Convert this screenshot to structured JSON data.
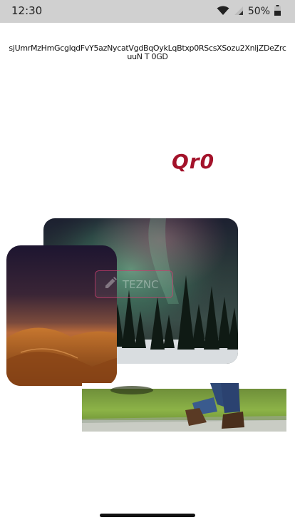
{
  "status_bar": {
    "time": "12:30",
    "battery": "50%",
    "icons": [
      "wifi-icon",
      "signal-icon",
      "battery-icon"
    ]
  },
  "header": {
    "text": "sjUmrMzHmGcglqdFvY5azNycatVgdBqOykLqBtxp0RScsXSozu2XnljZDeZrc uuN T 0GD"
  },
  "title": {
    "text": "Qr0",
    "color": "#a3122a"
  },
  "photos": [
    {
      "name": "aurora-photo",
      "subject": "northern lights over forest"
    },
    {
      "name": "desert-photo",
      "subject": "desert dunes at dusk"
    },
    {
      "name": "walking-photo",
      "subject": "person walking on grass path"
    }
  ],
  "edit_chip": {
    "label": "TEZNC",
    "icon": "pencil-icon"
  },
  "colors": {
    "status_bar_bg": "#d0d0d0",
    "accent": "#a3122a",
    "chip_border": "#c83c6e"
  }
}
